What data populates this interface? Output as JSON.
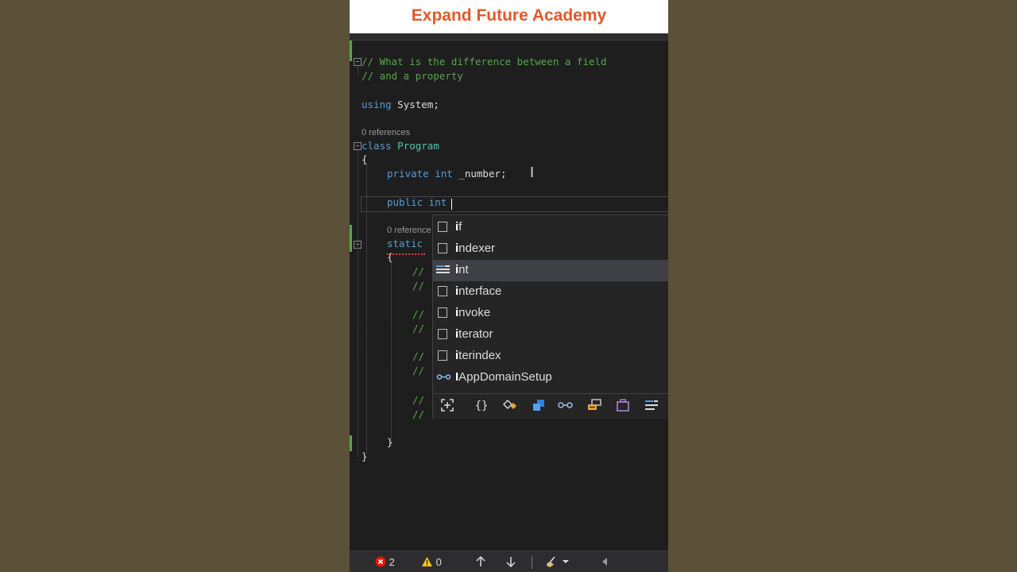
{
  "banner": {
    "title": "Expand Future Academy"
  },
  "code": {
    "line1": "// What is the difference between a field",
    "line2": "// and a property",
    "using_kw": "using",
    "using_ns": " System;",
    "refs_class": "0 references",
    "class_kw": "class",
    "class_name": " Program",
    "open_brace": "{",
    "field_private": "private",
    "field_int": " int",
    "field_name": " _number;",
    "prop_public": "public",
    "prop_int": " int",
    "refs_method": "0 reference",
    "static_kw": "static",
    "method_open": "{",
    "c1": "//",
    "c2": "//",
    "c3": "//",
    "c4": "//",
    "c5": "//",
    "c6": "//",
    "c7": "//",
    "c8": "//",
    "method_close": "}",
    "class_close": "}"
  },
  "completion": {
    "items": [
      {
        "first": "i",
        "rest": "f",
        "icon": "keyword-icon"
      },
      {
        "first": "i",
        "rest": "ndexer",
        "icon": "snippet-icon"
      },
      {
        "first": "i",
        "rest": "nt",
        "icon": "keyword-icon",
        "selected": true
      },
      {
        "first": "i",
        "rest": "nterface",
        "icon": "snippet-icon"
      },
      {
        "first": "i",
        "rest": "nvoke",
        "icon": "snippet-icon"
      },
      {
        "first": "i",
        "rest": "terator",
        "icon": "snippet-icon"
      },
      {
        "first": "i",
        "rest": "terindex",
        "icon": "snippet-icon"
      },
      {
        "first": "I",
        "rest": "AppDomainSetup",
        "icon": "interface-icon"
      }
    ],
    "filters": [
      "snippet-filter-icon",
      "namespace-filter-icon",
      "class-filter-icon",
      "struct-filter-icon",
      "interface-filter-icon",
      "enum-filter-icon",
      "delegate-filter-icon",
      "keyword-filter-icon"
    ]
  },
  "status": {
    "errors": "2",
    "warnings": "0"
  },
  "colors": {
    "banner_text": "#e0592a",
    "comment": "#57a64a",
    "keyword": "#569cd6",
    "type": "#4ec9b0",
    "editor_bg": "#1e1e1e"
  }
}
